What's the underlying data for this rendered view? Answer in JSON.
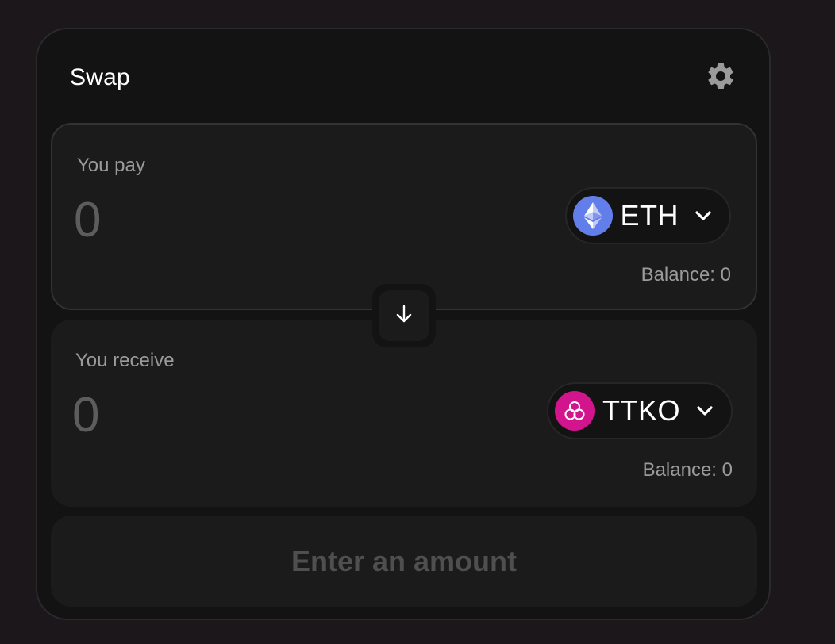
{
  "swap": {
    "title": "Swap",
    "settings_icon": "gear-icon"
  },
  "pay": {
    "label": "You pay",
    "amount_placeholder": "0",
    "token": {
      "symbol": "ETH",
      "icon": "eth-logo-icon",
      "color": "#627eea"
    },
    "balance": "Balance: 0"
  },
  "switch": {
    "icon": "arrow-down-icon"
  },
  "receive": {
    "label": "You receive",
    "amount_placeholder": "0",
    "token": {
      "symbol": "TTKO",
      "icon": "ttko-logo-icon",
      "color": "#d2148d"
    },
    "balance": "Balance: 0"
  },
  "action": {
    "label": "Enter an amount"
  },
  "colors": {
    "background": "#1b171b",
    "card": "#131313",
    "panel": "#1b1b1b",
    "muted_text": "#9b9b9b"
  }
}
